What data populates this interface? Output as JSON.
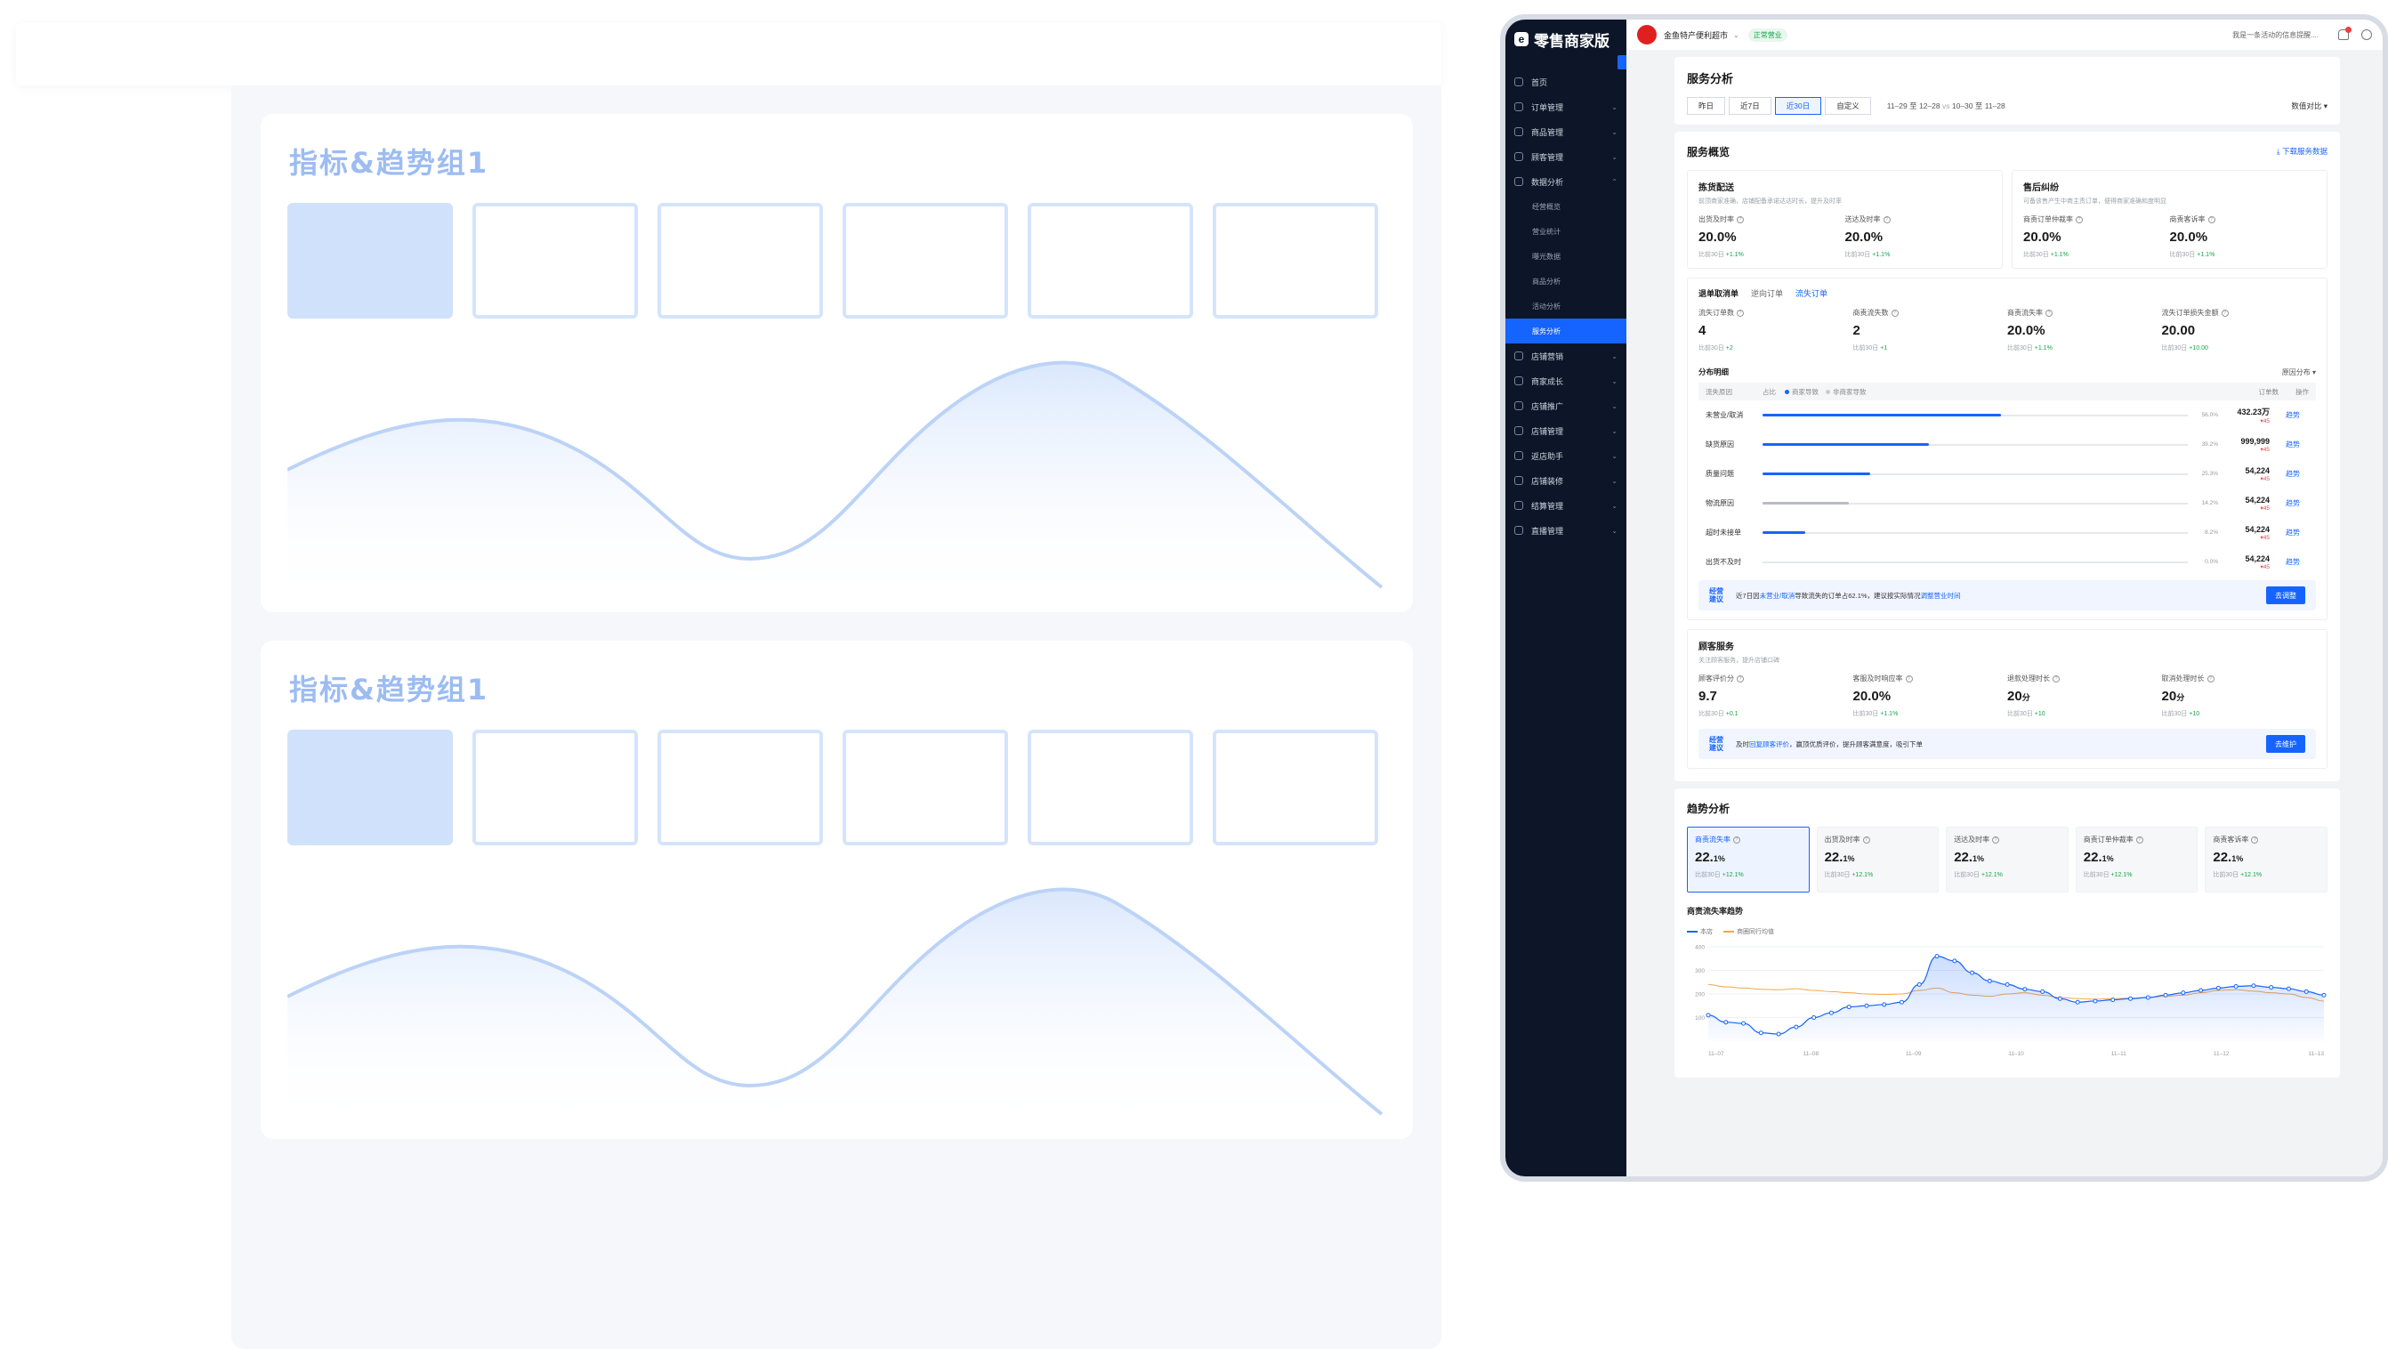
{
  "wireframe": {
    "cards": [
      {
        "title": "指标&趋势组1"
      },
      {
        "title": "指标&趋势组1"
      }
    ],
    "accent": "#d0e1fc"
  },
  "app": {
    "logo": "零售商家版",
    "logo_mark": "e",
    "store_name": "金鱼特产便利超市",
    "status": "正常营业",
    "notice": "我是一条活动的信息提醒....",
    "sidebar": [
      {
        "label": "首页",
        "chev": ""
      },
      {
        "label": "订单管理",
        "chev": "⌄"
      },
      {
        "label": "商品管理",
        "chev": "⌄"
      },
      {
        "label": "顾客管理",
        "chev": "⌄"
      },
      {
        "label": "数据分析",
        "chev": "⌃"
      }
    ],
    "sidebar_sub": [
      "经营概览",
      "营业统计",
      "曝光数据",
      "商品分析",
      "活动分析",
      "服务分析"
    ],
    "sidebar_rest": [
      "店铺营销",
      "商家成长",
      "店铺推广",
      "店铺管理",
      "返店助手",
      "店铺装修",
      "结算管理",
      "直播管理"
    ],
    "page_title": "服务分析",
    "date_tabs": [
      "昨日",
      "近7日",
      "近30日",
      "自定义"
    ],
    "active_date_tab": 2,
    "date_range": "11–29 至 12–28",
    "date_vs": "vs",
    "date_compare_range": "10–30 至 11–28",
    "compare_select": "数值对比",
    "overview": {
      "title": "服务概览",
      "download": "下载服务数据",
      "cards": [
        {
          "title": "拣货配送",
          "desc": "前顶商家准确，店铺配备承诺达达时长，提升及时率",
          "metrics": [
            {
              "label": "出货及时率",
              "value": "20.0%",
              "comp": "比前30日",
              "delta": "+1.1%"
            },
            {
              "label": "送达及时率",
              "value": "20.0%",
              "comp": "比前30日",
              "delta": "+1.1%"
            }
          ]
        },
        {
          "title": "售后纠纷",
          "desc": "可备该售产生中商主责订单，便得商家准确和度明显",
          "metrics": [
            {
              "label": "商责订单仲裁率",
              "value": "20.0%",
              "comp": "比前30日",
              "delta": "+1.1%"
            },
            {
              "label": "商责客诉率",
              "value": "20.0%",
              "comp": "比前30日",
              "delta": "+1.1%"
            }
          ]
        }
      ]
    },
    "loss": {
      "tabs": [
        "退单取消单",
        "逆向订单",
        "流失订单"
      ],
      "metrics": [
        {
          "label": "流失订单数",
          "value": "4",
          "comp": "比前30日",
          "delta": "+2"
        },
        {
          "label": "商责流失数",
          "value": "2",
          "comp": "比前30日",
          "delta": "+1"
        },
        {
          "label": "商责流失率",
          "value": "20.0%",
          "comp": "比前30日",
          "delta": "+1.1%"
        },
        {
          "label": "流失订单损失金额",
          "value": "20.00",
          "comp": "比前30日",
          "delta": "+10.00"
        }
      ],
      "dist_title": "分布明细",
      "dist_select": "原因分布",
      "table_headers": {
        "reason": "流失原因",
        "share": "占比",
        "merchant": "商家导致",
        "non_merchant": "非商家导致",
        "count": "订单数",
        "op": "操作"
      },
      "rows": [
        {
          "reason": "未营业/取消",
          "pct": 56.0,
          "pct_label": "56.0%",
          "count": "432.23万",
          "change": "▾45",
          "op": "趋势"
        },
        {
          "reason": "缺货原因",
          "pct": 39.2,
          "pct_label": "39.2%",
          "count": "999,999",
          "change": "▾45",
          "op": "趋势"
        },
        {
          "reason": "质量问题",
          "pct": 25.3,
          "pct_label": "25.3%",
          "count": "54,224",
          "change": "▾45",
          "op": "趋势"
        },
        {
          "reason": "物流原因",
          "pct": 20.2,
          "pct_label": "14.2%",
          "count": "54,224",
          "change": "▾45",
          "op": "趋势",
          "gray": true
        },
        {
          "reason": "超时未接单",
          "pct": 10.0,
          "pct_label": "8.2%",
          "count": "54,224",
          "change": "▾45",
          "op": "趋势"
        },
        {
          "reason": "出货不及时",
          "pct": 0.0,
          "pct_label": "0.0%",
          "count": "54,224",
          "change": "▾45",
          "op": "趋势"
        }
      ],
      "advice_tag": "经营建议",
      "advice_pre": "近7日因",
      "advice_hl1": "未营业/取消",
      "advice_mid": "导致流失的订单占62.1%，建议按实际情况",
      "advice_hl2": "调整营业时间",
      "advice_btn": "去调整"
    },
    "customer": {
      "title": "顾客服务",
      "desc": "关注顾客服务，提升店铺口碑",
      "metrics": [
        {
          "label": "顾客评价分",
          "value": "9.7",
          "unit": "",
          "comp": "比前30日",
          "delta": "+0.1"
        },
        {
          "label": "客服及时响应率",
          "value": "20.0%",
          "unit": "",
          "comp": "比前30日",
          "delta": "+1.1%"
        },
        {
          "label": "退款处理时长",
          "value": "20",
          "unit": "分",
          "comp": "比前30日",
          "delta": "+10"
        },
        {
          "label": "取消处理时长",
          "value": "20",
          "unit": "分",
          "comp": "比前30日",
          "delta": "+10"
        }
      ],
      "advice_tag": "经营建议",
      "advice_pre": "及时",
      "advice_hl1": "回复顾客评价",
      "advice_post": "，赢顶优质评价，提升顾客满意度，吸引下单",
      "advice_btn": "去维护"
    },
    "trend": {
      "title": "趋势分析",
      "cards": [
        {
          "label": "商责流失率",
          "value": "22.",
          "unit": "1%",
          "comp": "比前30日",
          "delta": "+12.1%"
        },
        {
          "label": "出货及时率",
          "value": "22.",
          "unit": "1%",
          "comp": "比前30日",
          "delta": "+12.1%"
        },
        {
          "label": "送达及时率",
          "value": "22.",
          "unit": "1%",
          "comp": "比前30日",
          "delta": "+12.1%"
        },
        {
          "label": "商责订单仲裁率",
          "value": "22.",
          "unit": "1%",
          "comp": "比前30日",
          "delta": "+12.1%"
        },
        {
          "label": "商责客诉率",
          "value": "22.",
          "unit": "1%",
          "comp": "比前30日",
          "delta": "+12.1%"
        }
      ],
      "chart_title": "商责流失率趋势",
      "legend": [
        "本店",
        "商圈同行均值"
      ]
    }
  },
  "chart_data": {
    "type": "line",
    "x": [
      "11–07",
      "11–08",
      "11–09",
      "11–10",
      "11–11",
      "11–12",
      "11–13"
    ],
    "yticks": [
      100,
      200,
      300,
      400
    ],
    "ylim": [
      0,
      400
    ],
    "series": [
      {
        "name": "本店",
        "color": "#1664ff",
        "values": [
          110,
          80,
          75,
          35,
          30,
          60,
          100,
          120,
          145,
          150,
          155,
          165,
          240,
          360,
          340,
          290,
          255,
          240,
          220,
          210,
          180,
          165,
          170,
          175,
          180,
          185,
          195,
          205,
          215,
          225,
          232,
          235,
          228,
          222,
          210,
          195
        ]
      },
      {
        "name": "商圈同行均值",
        "color": "#f5a54a",
        "values": [
          240,
          230,
          225,
          220,
          218,
          222,
          215,
          210,
          205,
          200,
          198,
          200,
          215,
          225,
          205,
          195,
          190,
          200,
          205,
          195,
          185,
          180,
          178,
          180,
          182,
          185,
          190,
          195,
          205,
          215,
          218,
          212,
          205,
          200,
          185,
          170
        ]
      }
    ]
  }
}
